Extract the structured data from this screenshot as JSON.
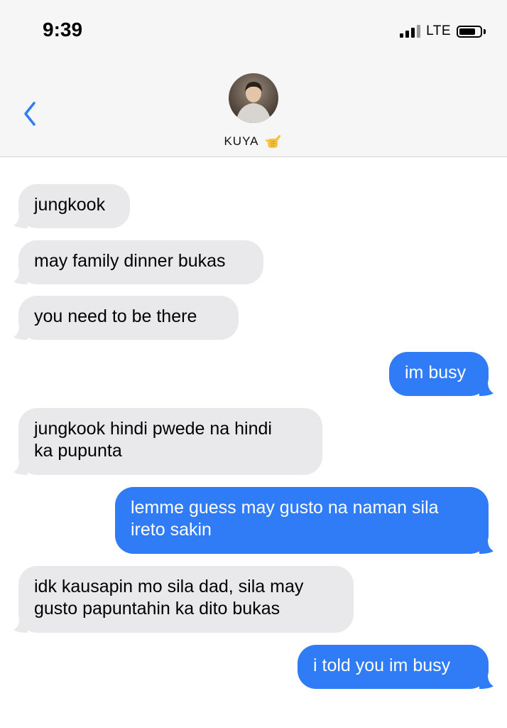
{
  "status_bar": {
    "time": "9:39",
    "network": "LTE",
    "battery_level": 0.8
  },
  "header": {
    "contact_name": "KUYA",
    "contact_emoji_icon": "call-me-hand-icon",
    "back_icon": "chevron-left-icon"
  },
  "colors": {
    "sent_bubble": "#2f7cf6",
    "received_bubble": "#e9e9eb",
    "accent": "#2f7cf6"
  },
  "messages": [
    {
      "direction": "received",
      "text": "jungkook"
    },
    {
      "direction": "received",
      "text": "may family dinner bukas"
    },
    {
      "direction": "received",
      "text": "you need to be there"
    },
    {
      "direction": "sent",
      "text": "im busy"
    },
    {
      "direction": "received",
      "text": "jungkook hindi pwede na hindi\nka pupunta"
    },
    {
      "direction": "sent",
      "text": "lemme guess may gusto na naman sila\nireto sakin"
    },
    {
      "direction": "received",
      "text": "idk kausapin mo sila dad, sila may\ngusto papuntahin ka dito bukas"
    },
    {
      "direction": "sent",
      "text": "i told you im busy"
    }
  ]
}
